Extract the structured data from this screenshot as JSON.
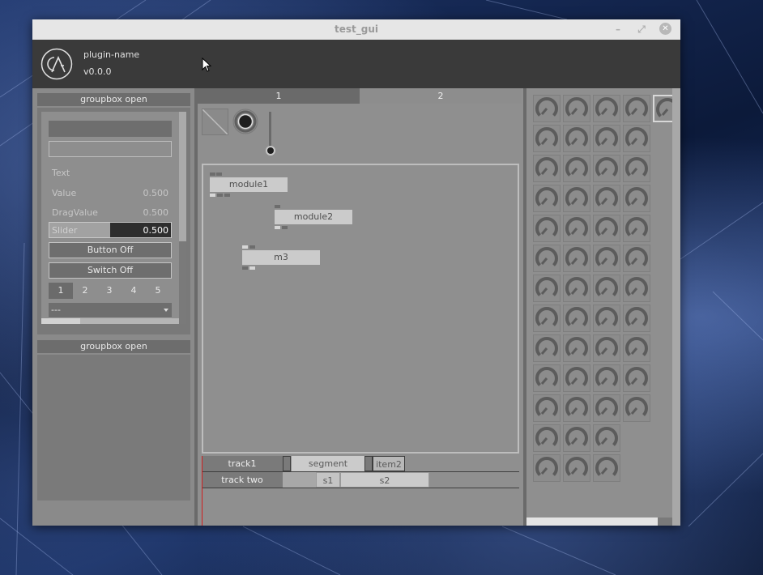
{
  "window": {
    "title": "test_gui",
    "minimize_icon": "minimize-icon",
    "maximize_icon": "maximize-icon",
    "close_icon": "close-icon"
  },
  "header": {
    "plugin_name": "plugin-name",
    "version": "v0.0.0",
    "logo_icon": "logo-icon"
  },
  "left_panel": {
    "groupbox1_title": "groupbox open",
    "groupbox2_title": "groupbox open",
    "text_label": "Text",
    "value_label": "Value",
    "value_value": "0.500",
    "drag_label": "DragValue",
    "drag_value": "0.500",
    "slider_label": "Slider",
    "slider_value": "0.500",
    "slider_fraction": 0.5,
    "button_label": "Button Off",
    "switch_label": "Switch Off",
    "radio_options": [
      "1",
      "2",
      "3",
      "4",
      "5"
    ],
    "radio_selected": "1",
    "combo_value": "---"
  },
  "center_panel": {
    "tabs": [
      "1",
      "2"
    ],
    "active_tab": "1",
    "nodes": [
      {
        "label": "module1"
      },
      {
        "label": "module2"
      },
      {
        "label": "m3"
      }
    ],
    "tracks": [
      {
        "name": "track1",
        "segments": [
          "segment",
          "item2"
        ]
      },
      {
        "name": "track two",
        "segments": [
          "s1",
          "s2"
        ]
      }
    ]
  },
  "right_panel": {
    "knob_icon": "knob-icon",
    "row_counts": [
      5,
      4,
      4,
      4,
      4,
      4,
      4,
      4,
      4,
      4,
      4,
      3,
      3
    ]
  },
  "colors": {
    "accent_dark": "#3a3a3a",
    "panel": "#8f8f8f",
    "playhead": "#d02020"
  }
}
